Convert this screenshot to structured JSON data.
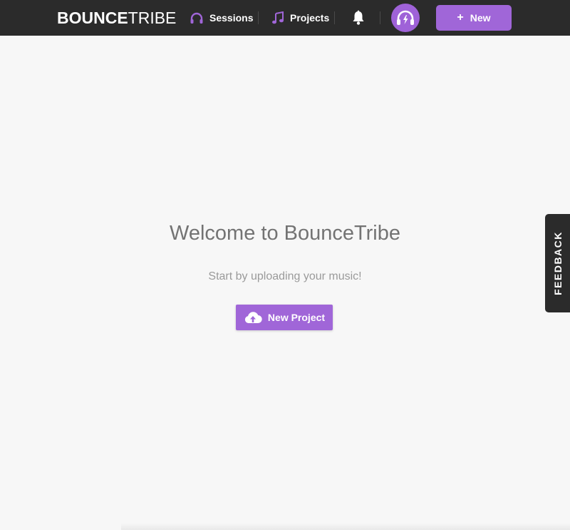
{
  "brand": {
    "logo_bold": "BOUNCE",
    "logo_light": "TRIBE"
  },
  "nav": {
    "sessions_label": "Sessions",
    "projects_label": "Projects",
    "sessions_icon": "headphones-icon",
    "projects_icon": "music-note-icon",
    "bell_icon": "bell-icon",
    "avatar_icon": "headphones-bolt-icon"
  },
  "header": {
    "new_button_label": "New",
    "new_button_icon": "+"
  },
  "main": {
    "title": "Welcome to BounceTribe",
    "subtitle": "Start by uploading your music!",
    "new_project_label": "New Project",
    "new_project_icon": "cloud-upload-icon"
  },
  "feedback": {
    "label": "FEEDBACK"
  },
  "colors": {
    "accent": "#a066d8",
    "topbar": "#2b2b2b",
    "background": "#f7f7f7"
  }
}
